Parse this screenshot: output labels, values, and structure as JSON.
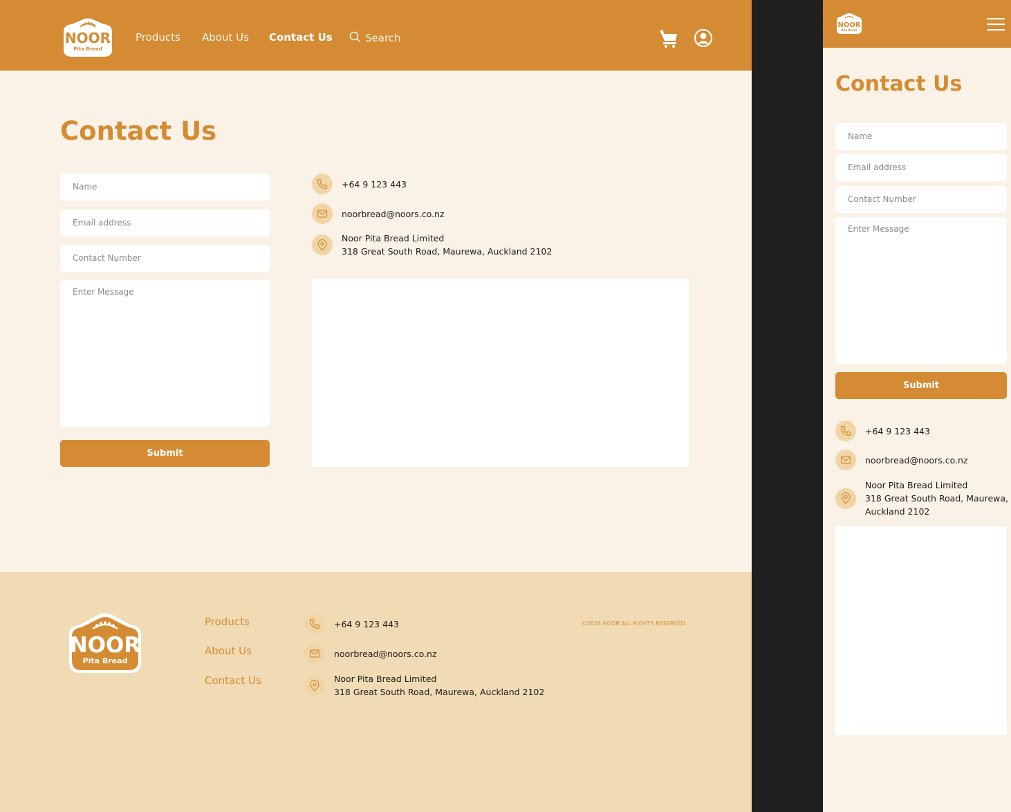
{
  "brand": {
    "name": "NOOR",
    "tagline": "Pita Bread",
    "primary_color": "#d58b33",
    "cream_color": "#faf2e6",
    "footer_color": "#f1dbb5"
  },
  "nav": {
    "products": "Products",
    "about": "About Us",
    "contact": "Contact Us",
    "search_label": "Search"
  },
  "header_icons": {
    "cart": "cart-icon",
    "account": "account-icon",
    "menu": "hamburger-menu-icon"
  },
  "page": {
    "title": "Contact Us"
  },
  "form": {
    "name_placeholder": "Name",
    "email_placeholder": "Email address",
    "phone_placeholder": "Contact Number",
    "message_placeholder": "Enter Message",
    "submit_label": "Submit"
  },
  "contact": {
    "phone": "+64 9 123 443",
    "email": "noorbread@noors.co.nz",
    "company": "Noor Pita Bread Limited",
    "address": "318 Great South Road, Maurewa, Auckland 2102",
    "address_line1": "318 Great South Road, Maurewa,",
    "address_line2": "Auckland 2102"
  },
  "footer": {
    "links": [
      "Products",
      "About Us",
      "Contact Us"
    ],
    "copyright": "©2024 NOOR ALL RIGHTS RESERVED."
  }
}
